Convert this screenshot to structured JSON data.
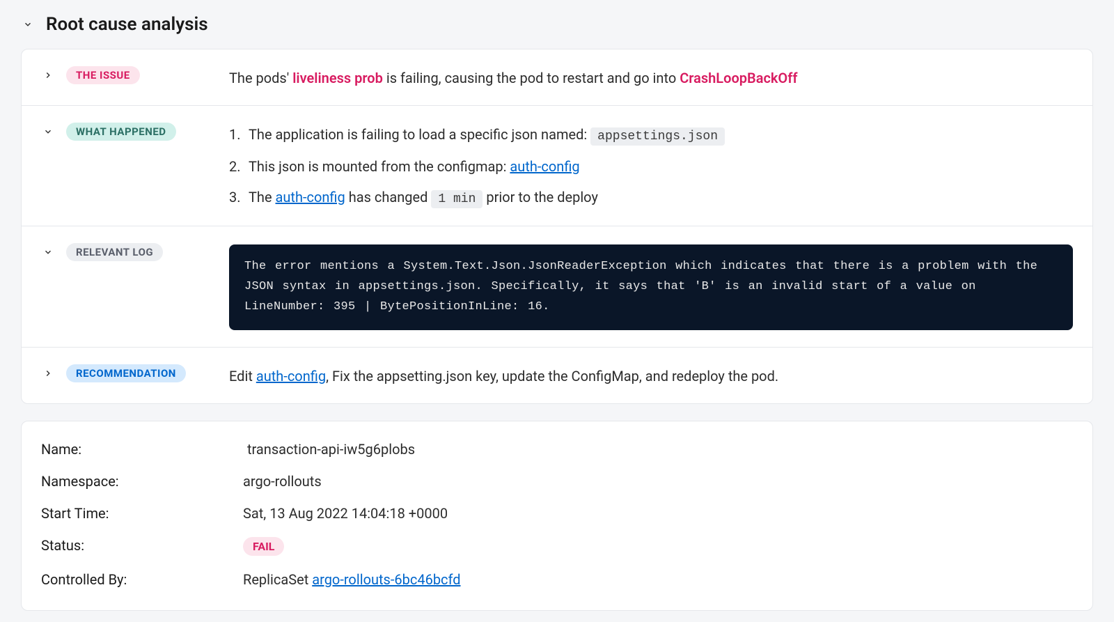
{
  "header": {
    "title": "Root cause analysis"
  },
  "sections": {
    "issue": {
      "badge": "THE ISSUE",
      "text_before": "The pods' ",
      "highlight1": "liveliness prob",
      "text_mid": " is failing, causing the pod to restart and go into ",
      "highlight2": "CrashLoopBackOff"
    },
    "what_happened": {
      "badge": "WHAT HAPPENED",
      "items": {
        "item1_text": "The application is failing to load a specific json named: ",
        "item1_code": "appsettings.json",
        "item2_text": "This json is mounted from the configmap: ",
        "item2_link": "auth-config",
        "item3_before": "The ",
        "item3_link": "auth-config",
        "item3_mid": " has changed ",
        "item3_code": "1 min",
        "item3_after": " prior to the deploy"
      }
    },
    "log": {
      "badge": "RELEVANT LOG",
      "content": "The error mentions a System.Text.Json.JsonReaderException which indicates that there is a problem with the JSON syntax in   appsettings.json. Specifically, it says that 'B' is an invalid start of a value on LineNumber: 395 | BytePositionInLine: 16."
    },
    "recommendation": {
      "badge": "RECOMMENDATION",
      "text_before": "Edit ",
      "link": "auth-config",
      "text_after": ", Fix the appsetting.json key, update the ConfigMap, and redeploy the pod."
    }
  },
  "info": {
    "name_label": "Name:",
    "name_value": "transaction-api-iw5g6plobs",
    "namespace_label": "Namespace:",
    "namespace_value": "argo-rollouts",
    "starttime_label": "Start Time:",
    "starttime_value": "Sat, 13 Aug 2022 14:04:18 +0000",
    "status_label": "Status:",
    "status_value": "FAIL",
    "controlled_label": "Controlled By:",
    "controlled_value_prefix": "ReplicaSet ",
    "controlled_link": "argo-rollouts-6bc46bcfd"
  }
}
